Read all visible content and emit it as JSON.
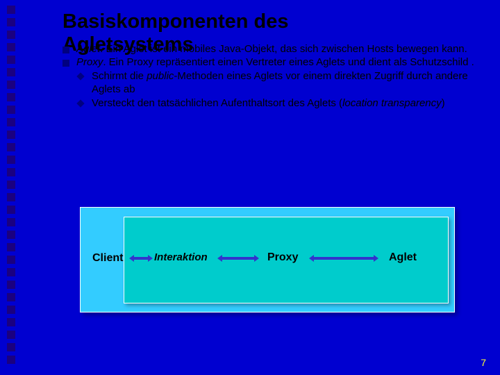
{
  "title_line1": "Basiskomponenten des",
  "title_line2": "Agletsystems",
  "bullets": [
    {
      "term": "Aglet",
      "text": ". Ein Aglet ist ein mobiles Java-Objekt, das sich zwischen Hosts bewegen kann."
    },
    {
      "term": "Proxy",
      "text": ". Ein Proxy repräsentiert einen Vertreter eines Aglets und dient als Schutzschild .",
      "subs": [
        {
          "pre": "Schirmt die ",
          "em": "public",
          "post": "-Methoden eines Aglets vor einem direkten Zugriff durch andere Aglets ab"
        },
        {
          "pre": "Versteckt den tatsächlichen Aufenthaltsort des Aglets (",
          "em": "location transparency",
          "post": ")"
        }
      ]
    }
  ],
  "diagram": {
    "client": "Client",
    "interaktion": "Interaktion",
    "proxy": "Proxy",
    "aglet": "Aglet"
  },
  "page": "7"
}
